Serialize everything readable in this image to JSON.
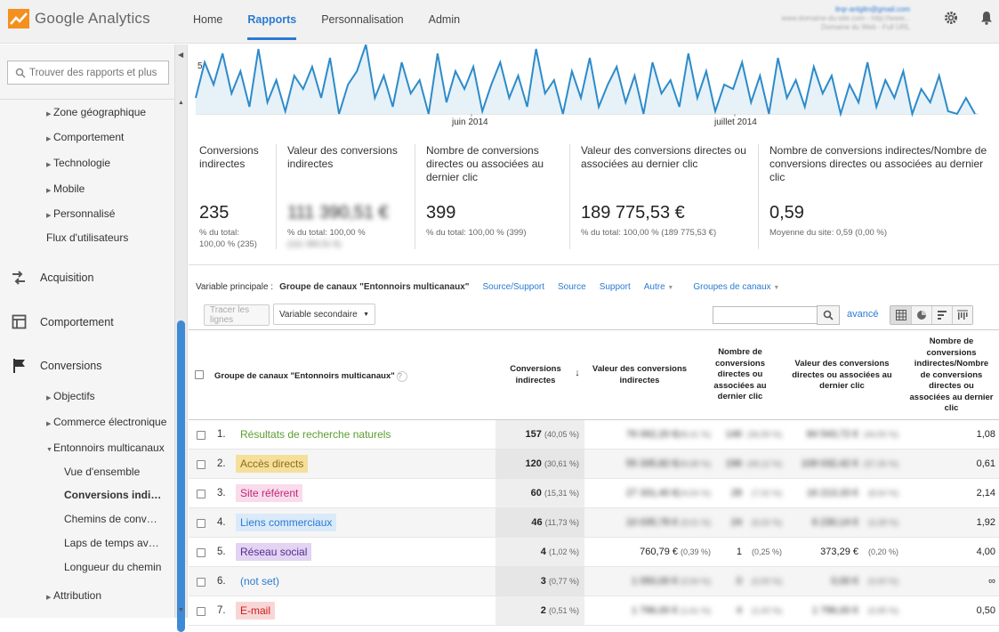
{
  "header": {
    "app_name": "Google Analytics",
    "nav": [
      "Home",
      "Rapports",
      "Personnalisation",
      "Admin"
    ],
    "account_email": "ilrqr-anlgltn@gmail.com",
    "account_line2": "www.domaine-du-site.com - http://www...",
    "account_line3": "Domaine du Web - Full URL"
  },
  "sidebar": {
    "search_placeholder": "Trouver des rapports et plus",
    "items": [
      "Zone géographique",
      "Comportement",
      "Technologie",
      "Mobile",
      "Personnalisé",
      "Flux d'utilisateurs",
      "Acquisition",
      "Comportement",
      "Conversions",
      "Objectifs",
      "Commerce électronique",
      "Entonnoirs multicanaux",
      "Vue d'ensemble",
      "Conversions indi…",
      "Chemins de conv…",
      "Laps de temps av…",
      "Longueur du chemin",
      "Attribution"
    ]
  },
  "chart": {
    "y_tick": "5",
    "x_ticks": [
      "juin 2014",
      "juillet 2014"
    ],
    "line_color": "#2d8bc9",
    "fill_color": "#e6f1f8"
  },
  "scorecards": [
    {
      "label": "Conversions indirectes",
      "value": "235",
      "sub1": "% du total:",
      "sub2": "100,00 % (235)"
    },
    {
      "label": "Valeur des conversions indirectes",
      "value": "111 390,51 €",
      "sub1": "% du total: 100,00 %",
      "sub2": "(111 390,51 €)"
    },
    {
      "label": "Nombre de conversions directes ou associées au dernier clic",
      "value": "399",
      "sub1": "% du total: 100,00 % (399)",
      "sub2": ""
    },
    {
      "label": "Valeur des conversions directes ou associées au dernier clic",
      "value": "189 775,53 €",
      "sub1": "% du total: 100,00 % (189 775,53 €)",
      "sub2": ""
    },
    {
      "label": "Nombre de conversions indirectes/Nombre de conversions directes ou associées au dernier clic",
      "value": "0,59",
      "sub1": "Moyenne du site: 0,59 (0,00 %)",
      "sub2": ""
    }
  ],
  "primary": {
    "label": "Variable principale :",
    "selected": "Groupe de canaux \"Entonnoirs multicanaux\"",
    "links": [
      "Source/Support",
      "Source",
      "Support"
    ],
    "autre": "Autre",
    "groupes": "Groupes de canaux"
  },
  "toolbar": {
    "trace_label": "Tracer les lignes",
    "secondary_label": "Variable secondaire",
    "advanced_label": "avancé"
  },
  "table": {
    "headers": [
      "Groupe de canaux \"Entonnoirs multicanaux\"",
      "Conversions indirectes",
      "Valeur des conversions indirectes",
      "Nombre de conversions directes ou associées au dernier clic",
      "Valeur des conversions directes ou associées au dernier clic",
      "Nombre de conversions indirectes/Nombre de conversions directes ou associées au dernier clic"
    ],
    "rows": [
      {
        "n": "1.",
        "channel": "Résultats de recherche naturels",
        "color": "#5a9e2f",
        "bg": "transparent",
        "conv": "157",
        "conv_pct": "(40,05 %)",
        "val": "76 062,20 €",
        "val_pct": "(68,41 %)",
        "direct": "146",
        "direct_pct": "(36,59 %)",
        "dval": "84 543,72 €",
        "dval_pct": "(44,55 %)",
        "ratio": "1,08"
      },
      {
        "n": "2.",
        "channel": "Accès directs",
        "color": "#8a6d1c",
        "bg": "#f5df9a",
        "conv": "120",
        "conv_pct": "(30,61 %)",
        "val": "55 335,82 €",
        "val_pct": "(49,68 %)",
        "direct": "196",
        "direct_pct": "(49,12 %)",
        "dval": "109 032,42 €",
        "dval_pct": "(57,45 %)",
        "ratio": "0,61"
      },
      {
        "n": "3.",
        "channel": "Site référent",
        "color": "#c0267a",
        "bg": "#f9dceb",
        "conv": "60",
        "conv_pct": "(15,31 %)",
        "val": "27 331,40 €",
        "val_pct": "(24,54 %)",
        "direct": "28",
        "direct_pct": "(7,02 %)",
        "dval": "16 213,33 €",
        "dval_pct": "(8,54 %)",
        "ratio": "2,14"
      },
      {
        "n": "4.",
        "channel": "Liens commerciaux",
        "color": "#2b7bd1",
        "bg": "#dbeaf9",
        "conv": "46",
        "conv_pct": "(11,73 %)",
        "val": "10 035,78 €",
        "val_pct": "(9,01 %)",
        "direct": "24",
        "direct_pct": "(6,02 %)",
        "dval": "6 230,14 €",
        "dval_pct": "(3,28 %)",
        "ratio": "1,92"
      },
      {
        "n": "5.",
        "channel": "Réseau social",
        "color": "#5b2a8f",
        "bg": "#e2d4f2",
        "conv": "4",
        "conv_pct": "(1,02 %)",
        "val": "760,79 €",
        "val_pct": "(0,39 %)",
        "direct": "1",
        "direct_pct": "(0,25 %)",
        "dval": "373,29 €",
        "dval_pct": "(0,20 %)",
        "ratio": "4,00"
      },
      {
        "n": "6.",
        "channel": "(not set)",
        "color": "#2b7bd1",
        "bg": "transparent",
        "conv": "3",
        "conv_pct": "(0,77 %)",
        "val": "1 050,00 €",
        "val_pct": "(0,94 %)",
        "direct": "0",
        "direct_pct": "(0,00 %)",
        "dval": "0,00 €",
        "dval_pct": "(0,00 %)",
        "ratio": "∞"
      },
      {
        "n": "7.",
        "channel": "E-mail",
        "color": "#c91c1c",
        "bg": "#f9d6d6",
        "conv": "2",
        "conv_pct": "(0,51 %)",
        "val": "1 796,00 €",
        "val_pct": "(1,61 %)",
        "direct": "4",
        "direct_pct": "(1,00 %)",
        "dval": "1 796,00 €",
        "dval_pct": "(0,95 %)",
        "ratio": "0,50"
      }
    ]
  }
}
